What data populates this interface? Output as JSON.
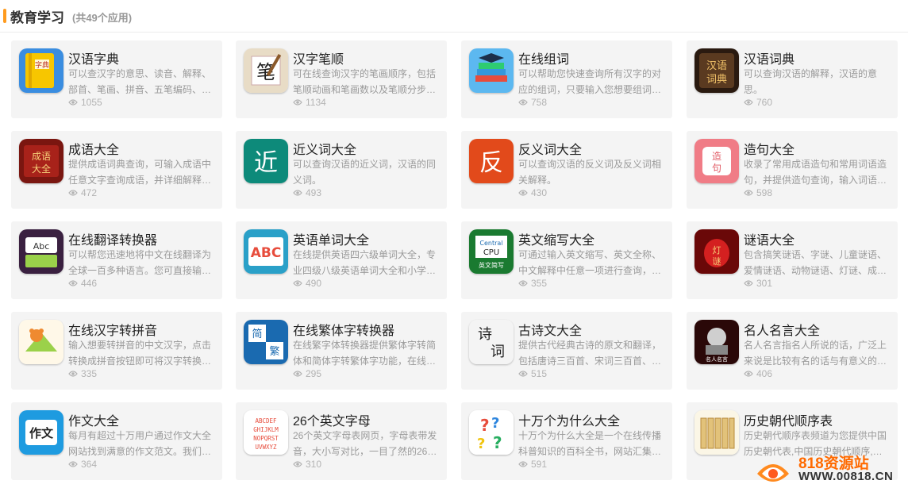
{
  "header": {
    "title": "教育学习",
    "count": "(共49个应用)"
  },
  "apps": [
    {
      "name": "汉语字典",
      "desc": "可以查汉字的意思、读音、解释、部首、笔画、拼音、五笔编码、…",
      "views": "1055",
      "icon": "book-icon",
      "color": "#f5c400"
    },
    {
      "name": "汉字笔顺",
      "desc": "可在线查询汉字的笔画顺序，包括笔顺动画和笔画数以及笔顺分步…",
      "views": "1134",
      "icon": "writing-brush-icon",
      "color": "#c9a26b"
    },
    {
      "name": "在线组词",
      "desc": "可以帮助您快速查询所有汉字的对应的组词，只要输入您想要组词…",
      "views": "758",
      "icon": "books-graduate-icon",
      "color": "#3a8fd8"
    },
    {
      "name": "汉语词典",
      "desc": "可以查询汉语的解释，汉语的意思。",
      "views": "760",
      "icon": "dictionary-icon",
      "color": "#3d2a1a"
    },
    {
      "name": "成语大全",
      "desc": "提供成语词典查询，可输入成语中任意文字查询成语，并详细解释…",
      "views": "472",
      "icon": "idiom-book-icon",
      "color": "#8c1a14"
    },
    {
      "name": "近义词大全",
      "desc": "可以查询汉语的近义词，汉语的同义词。",
      "views": "493",
      "icon": "synonym-icon",
      "color": "#0d8a7a"
    },
    {
      "name": "反义词大全",
      "desc": "可以查询汉语的反义词及反义词相关解释。",
      "views": "430",
      "icon": "antonym-icon",
      "color": "#e24a1b"
    },
    {
      "name": "造句大全",
      "desc": "收录了常用成语造句和常用词语造句，并提供造句查询，输入词语…",
      "views": "598",
      "icon": "sentence-icon",
      "color": "#f07c86"
    },
    {
      "name": "在线翻译转换器",
      "desc": "可以帮您迅速地将中文在线翻译为全球一百多种语言。您可直接输…",
      "views": "446",
      "icon": "translate-icon",
      "color": "#4a2a5a"
    },
    {
      "name": "英语单词大全",
      "desc": "在线提供英语四六级单词大全，专业四级八级英语单词大全和小学…",
      "views": "490",
      "icon": "abc-book-icon",
      "color": "#2aa0c8"
    },
    {
      "name": "英文缩写大全",
      "desc": "可通过输入英文缩写、英文全称、中文解释中任意一项进行查询，…",
      "views": "355",
      "icon": "cpu-icon",
      "color": "#1a8a3a"
    },
    {
      "name": "谜语大全",
      "desc": "包含搞笑谜语、字谜、儿童谜语、爱情谜语、动物谜语、灯谜、成…",
      "views": "301",
      "icon": "lantern-icon",
      "color": "#b01818"
    },
    {
      "name": "在线汉字转拼音",
      "desc": "输入想要转拼音的中文汉字，点击转换成拼音按钮即可将汉字转换…",
      "views": "335",
      "icon": "teddy-bear-icon",
      "color": "#8fcf4a"
    },
    {
      "name": "在线繁体字转换器",
      "desc": "在线繁字体转换器提供繁体字转简体和简体字转繁体字功能，在线…",
      "views": "295",
      "icon": "traditional-icon",
      "color": "#1a6ab0"
    },
    {
      "name": "古诗文大全",
      "desc": "提供古代经典古诗的原文和翻译，包括唐诗三百首、宋词三百首、…",
      "views": "515",
      "icon": "poem-icon",
      "color": "#ececec"
    },
    {
      "name": "名人名言大全",
      "desc": "名人名言指名人所说的话，广泛上来说是比较有名的话与有意义的…",
      "views": "406",
      "icon": "portrait-icon",
      "color": "#3a0e0e"
    },
    {
      "name": "作文大全",
      "desc": "每月有超过十万用户通过作文大全网站找到满意的作文范文。我们…",
      "views": "364",
      "icon": "essay-icon",
      "color": "#1e9be0"
    },
    {
      "name": "26个英文字母",
      "desc": "26个英文字母表网页，字母表带发音，大小写对比，一目了然的26…",
      "views": "310",
      "icon": "alphabet-icon",
      "color": "#ffffff"
    },
    {
      "name": "十万个为什么大全",
      "desc": "十万个为什么大全是一个在线传播科普知识的百科全书，网站汇集…",
      "views": "591",
      "icon": "question-marks-icon",
      "color": "#ffffff"
    },
    {
      "name": "历史朝代顺序表",
      "desc": "历史朝代顺序表频道为您提供中国历史朝代表,中国历史朝代顺序,…",
      "views": "",
      "icon": "bamboo-scroll-icon",
      "color": "#f5f0e0"
    }
  ],
  "watermark": {
    "text": "818资源站",
    "url": "WWW.00818.CN"
  }
}
